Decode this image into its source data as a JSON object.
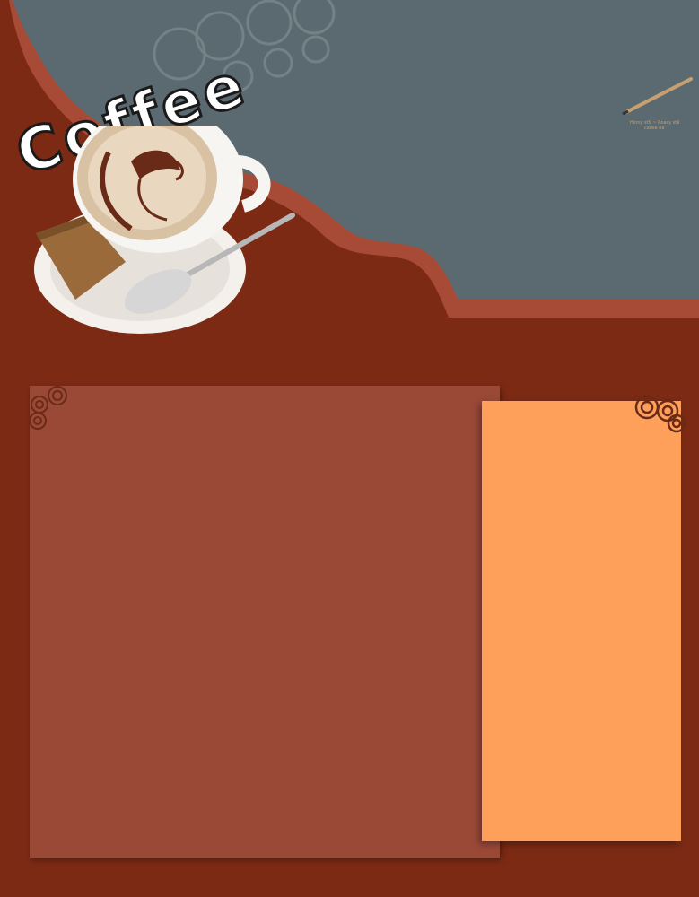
{
  "header": {
    "logo_text": "Coffee",
    "pencil_caption_line1": "Hinny st9 ~ Roasy st9",
    "pencil_caption_line2": "cause ea"
  },
  "colors": {
    "background": "#7c2a14",
    "header_slate": "#5a6a70",
    "wave_accent": "#a84b36",
    "main_panel": "#9b4937",
    "side_panel": "#ffa05a",
    "swirl": "#6a2a18"
  },
  "icons": {
    "cup": "coffee-cup-illustration",
    "pencil": "pencil-icon",
    "swirl_left": "swirl-ornament-icon",
    "swirl_right": "swirl-ornament-icon"
  }
}
